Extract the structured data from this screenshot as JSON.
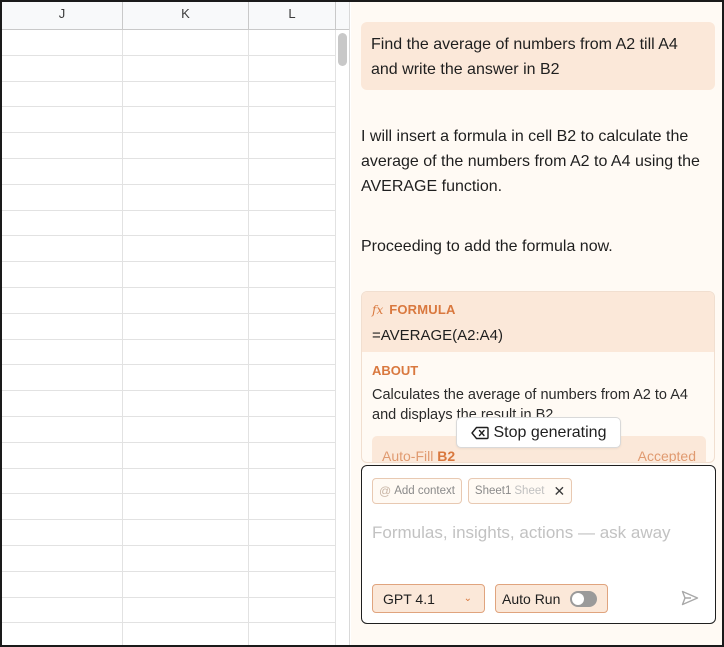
{
  "sheet": {
    "columns": [
      "J",
      "K",
      "L"
    ],
    "row_count": 24
  },
  "chat": {
    "user_message": "Find the average of numbers from A2 till A4 and write the answer in B2",
    "assistant_paragraph_1": "I will insert a formula in cell B2 to calculate the average of the numbers from A2 to A4 using the AVERAGE function.",
    "assistant_paragraph_2": "Proceeding to add the formula now.",
    "formula_card": {
      "icon": "fx-icon",
      "label": "FORMULA",
      "formula": "=AVERAGE(A2:A4)",
      "about_label": "ABOUT",
      "about_text": "Calculates the average of numbers from A2 to A4 and displays the result in B2.",
      "autofill_prefix": "Auto-Fill",
      "autofill_cell": "B2",
      "status": "Accepted"
    },
    "stop_button": "Stop generating"
  },
  "composer": {
    "add_context": "Add context",
    "sheet_chip_name": "Sheet1",
    "sheet_chip_suffix": "Sheet",
    "placeholder": "Formulas, insights, actions — ask away",
    "model": "GPT 4.1",
    "auto_run_label": "Auto Run",
    "auto_run_on": false
  },
  "colors": {
    "accent": "#d9783e",
    "bubble": "#fbe8d9",
    "panel_bg": "#fffaf4"
  }
}
